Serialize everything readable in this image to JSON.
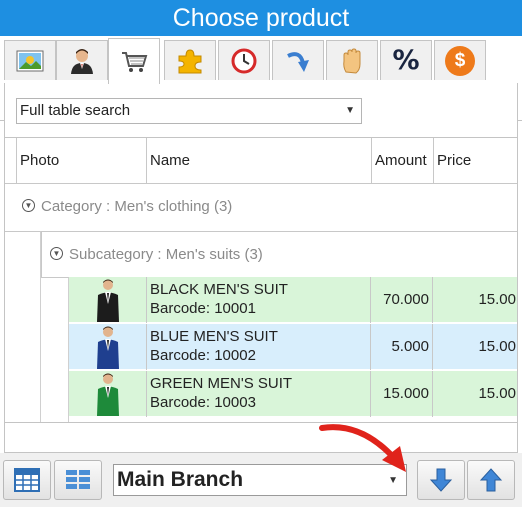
{
  "window": {
    "title": "Choose product"
  },
  "tabs": [
    {
      "icon": "image-icon",
      "active": false
    },
    {
      "icon": "user-icon",
      "active": false
    },
    {
      "icon": "shopping-cart-icon",
      "active": true
    },
    {
      "icon": "puzzle-icon",
      "active": false
    },
    {
      "icon": "clock-icon",
      "active": false
    },
    {
      "icon": "redo-arrow-icon",
      "active": false
    },
    {
      "icon": "hand-icon",
      "active": false
    },
    {
      "icon": "percent-icon",
      "active": false,
      "text": "%"
    },
    {
      "icon": "dollar-coin-icon",
      "active": false,
      "text": "$"
    }
  ],
  "search": {
    "value": "Full table search"
  },
  "table": {
    "columns": {
      "photo": "Photo",
      "name": "Name",
      "amount": "Amount",
      "price": "Price"
    },
    "group_category": "Category : Men's clothing (3)",
    "group_subcategory": "Subcategory : Men's suits (3)",
    "rows": [
      {
        "name": "BLACK MEN'S SUIT",
        "barcode": "Barcode: 10001",
        "amount": "70.000",
        "price": "15.00",
        "suit_color": "#1c1c1c",
        "bg": "#d9f5d9"
      },
      {
        "name": "BLUE MEN'S SUIT",
        "barcode": "Barcode: 10002",
        "amount": "5.000",
        "price": "15.00",
        "suit_color": "#1f3f8f",
        "bg": "#d8eefc"
      },
      {
        "name": "GREEN MEN'S SUIT",
        "barcode": "Barcode: 10003",
        "amount": "15.000",
        "price": "15.00",
        "suit_color": "#1e8a3a",
        "bg": "#d9f5d9"
      }
    ]
  },
  "branch": {
    "value": "Main Branch"
  },
  "colors": {
    "title_bar": "#1e8fe1",
    "annotation_arrow": "#e0231b"
  }
}
